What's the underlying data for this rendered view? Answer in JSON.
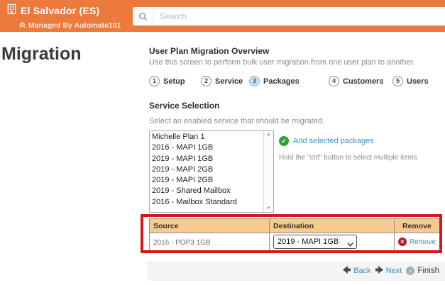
{
  "header": {
    "brand": "El Salvador (ES)",
    "managed_by": "Managed By Automate101",
    "search_placeholder": "Search"
  },
  "page": {
    "title": "Migration"
  },
  "overview": {
    "title": "User Plan Migration Overview",
    "description": "Use this screen to perform bulk user migration from one user plan to another."
  },
  "steps": [
    {
      "number": "1",
      "label": "Setup"
    },
    {
      "number": "2",
      "label": "Service"
    },
    {
      "number": "3",
      "label": "Packages"
    },
    {
      "number": "4",
      "label": "Customers"
    },
    {
      "number": "5",
      "label": "Users"
    }
  ],
  "service_selection": {
    "title": "Service Selection",
    "instruction": "Select an enabled service that should be migrated.",
    "services": [
      "Michelle Plan 1",
      "2016 - MAPI 1GB",
      "2019 - MAPI 1GB",
      "2019 - MAPI 2GB",
      "2019 - MAPI 2GB",
      "2019 - Shared Mailbox",
      "2016 - Mailbox Standard"
    ],
    "add_link": "Add selected packages",
    "hint": "Hold the \"ctrl\" button to select multiple items"
  },
  "mapping_table": {
    "headers": {
      "source": "Source",
      "destination": "Destination",
      "remove": "Remove"
    },
    "rows": [
      {
        "source": "2016 - POP3 1GB",
        "destination": "2019 - MAPI 1GB",
        "remove_label": "Remove"
      }
    ]
  },
  "footer_nav": {
    "back": "Back",
    "next": "Next",
    "finish": "Finish"
  },
  "colors": {
    "header_orange": "#EC7A3C",
    "link_blue": "#3E8EC0",
    "table_header_bg": "#F9CA90",
    "annotation_red": "#D6181C",
    "success_green": "#2EA43C",
    "remove_red": "#AD2230",
    "step_active_bg": "#CDE0ED"
  }
}
